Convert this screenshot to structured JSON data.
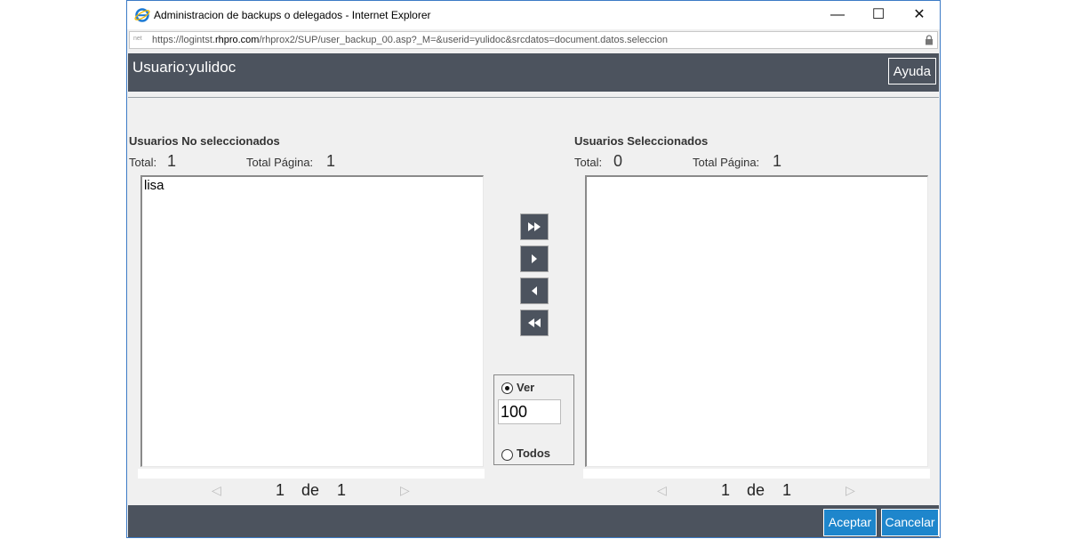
{
  "window": {
    "title": "Administracion de backups o delegados - Internet Explorer",
    "url_prefix": "https://logintst.",
    "url_domain": "rhpro.com",
    "url_rest": "/rhprox2/SUP/user_backup_00.asp?_M=&userid=yulidoc&srcdatos=document.datos.seleccion",
    "favicon_text": "net",
    "minimize_symbol": "—",
    "maximize_symbol": "☐",
    "close_symbol": "✕"
  },
  "header": {
    "title": "Usuario:yulidoc",
    "help_label": "Ayuda"
  },
  "left": {
    "title": "Usuarios No seleccionados",
    "total_label": "Total:",
    "total_value": "1",
    "page_total_label": "Total Página:",
    "page_total_value": "1",
    "items": [
      "lisa"
    ],
    "pager": {
      "current": "1",
      "de": "de",
      "total": "1"
    }
  },
  "right": {
    "title": "Usuarios Seleccionados",
    "total_label": "Total:",
    "total_value": "0",
    "page_total_label": "Total Página:",
    "page_total_value": "1",
    "items": [],
    "pager": {
      "current": "1",
      "de": "de",
      "total": "1"
    }
  },
  "move_buttons": [
    {
      "name": "move-all-right-button",
      "icon": "double-right-arrow-icon"
    },
    {
      "name": "move-right-button",
      "icon": "right-arrow-icon"
    },
    {
      "name": "move-left-button",
      "icon": "left-arrow-icon"
    },
    {
      "name": "move-all-left-button",
      "icon": "double-left-arrow-icon"
    }
  ],
  "view_options": {
    "ver_label": "Ver",
    "ver_value": "100",
    "todos_label": "Todos",
    "selected": "ver"
  },
  "footer": {
    "accept_label": "Aceptar",
    "cancel_label": "Cancelar"
  },
  "colors": {
    "header_bg": "#4c535e",
    "button_blue": "#1e86cc",
    "window_border": "#3c7bc6"
  }
}
